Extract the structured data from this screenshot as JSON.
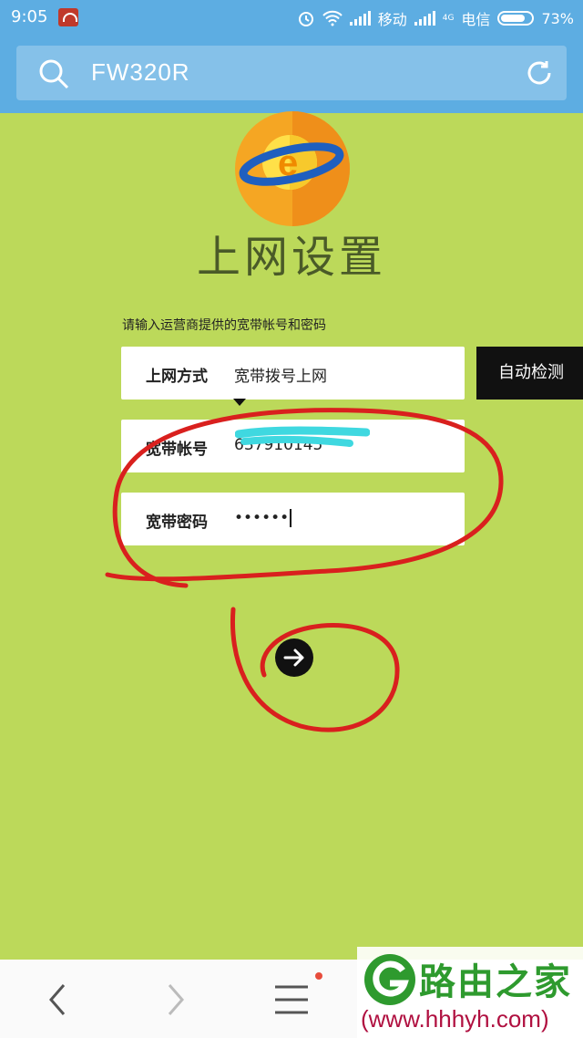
{
  "status_bar": {
    "time": "9:05",
    "carrier1": "移动",
    "carrier2": "电信",
    "network_type": "4G",
    "battery": "73%"
  },
  "search": {
    "query": "FW320R"
  },
  "page": {
    "title": "上网设置",
    "hint": "请输入运营商提供的宽带帐号和密码"
  },
  "form": {
    "mode_label": "上网方式",
    "mode_value": "宽带拨号上网",
    "detect_button": "自动检测",
    "account_label": "宽带帐号",
    "account_value": "637910145",
    "password_label": "宽带密码",
    "password_value": "••••••"
  },
  "watermark": {
    "name": "路由之家",
    "url": "(www.hhhyh.com)"
  },
  "colors": {
    "background": "#bcd95a",
    "header": "#5dade2",
    "annotation": "#d9201e"
  },
  "icons": {
    "search": "search-icon",
    "refresh": "refresh-icon",
    "next": "arrow-right-icon",
    "back": "chevron-left-icon",
    "forward": "chevron-right-icon",
    "menu": "menu-icon"
  }
}
